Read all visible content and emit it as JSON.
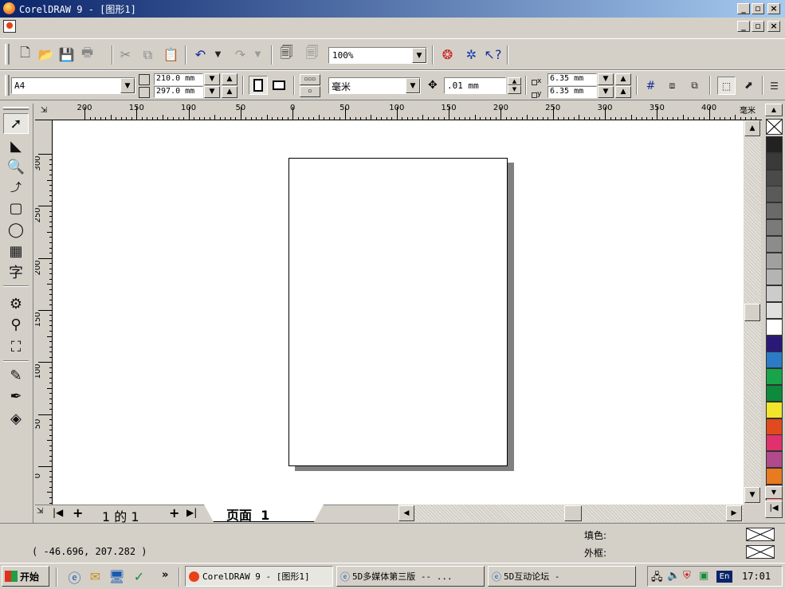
{
  "window": {
    "title": "CorelDRAW 9 - [图形1]"
  },
  "toolbar": {
    "zoom": "100%"
  },
  "propbar": {
    "paper_size": "A4",
    "width": "210.0 mm",
    "height": "297.0 mm",
    "units": "毫米",
    "nudge": ".01 mm",
    "dup_x": "6.35 mm",
    "dup_y": "6.35 mm",
    "dup_x_label": "x",
    "dup_y_label": "y"
  },
  "ruler": {
    "h_labels": [
      "200",
      "150",
      "100",
      "50",
      "0",
      "50",
      "100",
      "150",
      "200",
      "250",
      "300",
      "350",
      "400"
    ],
    "v_labels": [
      "300",
      "250",
      "200",
      "150",
      "100",
      "50",
      "0"
    ],
    "units_label": "毫米"
  },
  "page_nav": {
    "first": "|◀",
    "prev_add": "+",
    "position": "1 的 1",
    "next_add": "+",
    "last": "▶|",
    "tab_label": "页面  1"
  },
  "status": {
    "coords": "( -46.696, 207.282 )",
    "fill_label": "填色:",
    "outline_label": "外框:"
  },
  "taskbar": {
    "start": "开始",
    "chevron": "»",
    "tasks": [
      "CorelDRAW 9 - [图形1]",
      "5D多媒体第三版 -- ...",
      "5D互动论坛 -"
    ],
    "lang": "En",
    "clock": "17:01"
  },
  "palette": [
    "#222222",
    "#3a3a3a",
    "#4a4a4a",
    "#5a5a5a",
    "#6a6a6a",
    "#7a7a7a",
    "#8c8c8c",
    "#a0a0a0",
    "#b4b4b4",
    "#cccccc",
    "#e0e0e0",
    "#ffffff",
    "#2a1a78",
    "#2c7bc6",
    "#1aa44a",
    "#0d8a3a",
    "#f2e62a",
    "#e04a1e",
    "#e0306e",
    "#b04a8a",
    "#e87a20",
    "#f0a0a0",
    "#706660"
  ]
}
